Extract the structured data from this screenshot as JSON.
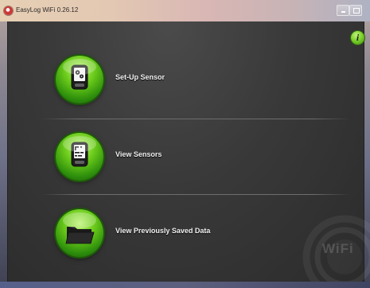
{
  "window": {
    "title": "EasyLog WiFi 0.26.12",
    "app_icon": "easylog-app-icon",
    "controls": [
      "minimize-icon",
      "maximize-icon"
    ]
  },
  "info_button": {
    "label": "i",
    "icon": "info-icon",
    "color": "#7ed22c"
  },
  "menu": [
    {
      "label": "Set-Up Sensor",
      "icon": "gears-device-icon"
    },
    {
      "label": "View Sensors",
      "icon": "sensor-readings-icon"
    },
    {
      "label": "View Previously Saved Data",
      "icon": "folder-icon"
    }
  ],
  "watermark": {
    "text": "WiFi",
    "icon": "wifi-ring-icon"
  },
  "colors": {
    "accent_green": "#69c919",
    "panel_background": "#393939",
    "text": "#f1f1f1"
  }
}
